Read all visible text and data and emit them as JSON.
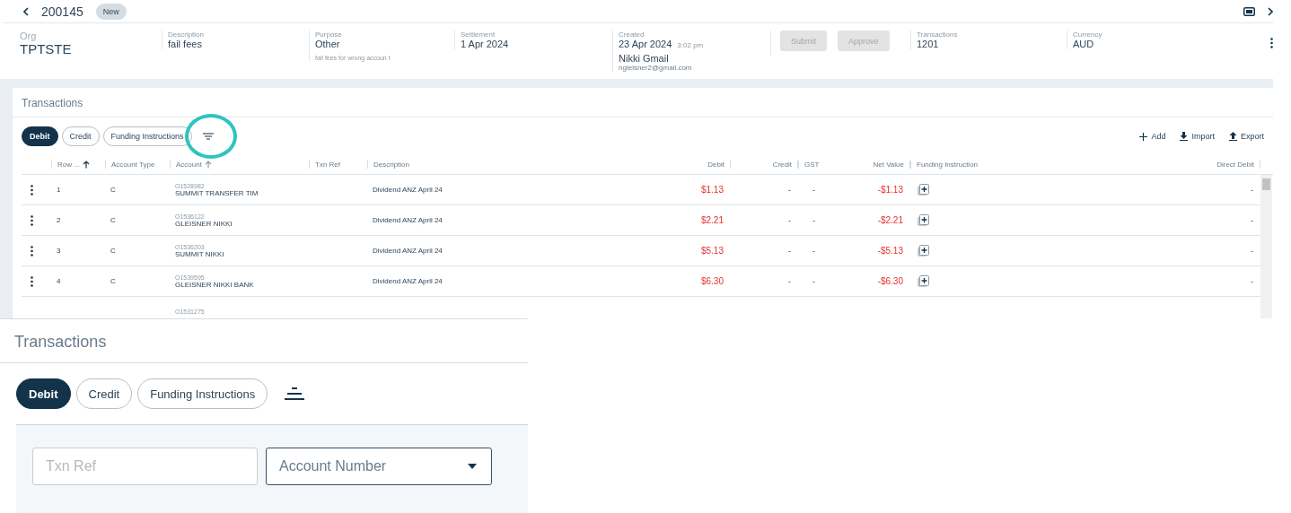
{
  "header": {
    "id": "200145",
    "badge": "New"
  },
  "summary": {
    "org": {
      "label": "Org",
      "value": "TPTSTE"
    },
    "fields": [
      {
        "kind": "plain",
        "label": "Description",
        "value": "fail fees"
      },
      {
        "kind": "note",
        "label": "Purpose",
        "value": "Other",
        "note": "fail fees for wrong accoun t"
      },
      {
        "kind": "plain",
        "label": "Settlement",
        "value": "1 Apr 2024"
      },
      {
        "kind": "created",
        "label": "Created",
        "value": "23 Apr 2024",
        "time": "3:02 pm",
        "name": "Nikki Gmail",
        "email": "ngleisner2@gmail.com"
      },
      {
        "kind": "buttons",
        "buttons": [
          {
            "label": "Submit",
            "disabled": true
          },
          {
            "label": "Approve",
            "disabled": true
          }
        ]
      },
      {
        "kind": "plain",
        "label": "Transactions",
        "value": "1201"
      },
      {
        "kind": "plain",
        "label": "Currency",
        "value": "AUD"
      }
    ]
  },
  "panel": {
    "title": "Transactions",
    "tabs": [
      {
        "label": "Debit",
        "selected": true
      },
      {
        "label": "Credit",
        "selected": false
      },
      {
        "label": "Funding Instructions",
        "selected": false
      }
    ],
    "filter_highlighted": true,
    "actions": [
      {
        "kind": "add",
        "label": "Add"
      },
      {
        "kind": "import",
        "label": "Import"
      },
      {
        "kind": "export",
        "label": "Export"
      }
    ],
    "columns": [
      {
        "label": "Row ...",
        "sorted": true
      },
      {
        "label": "Account Type",
        "sorted": false
      },
      {
        "label": "Account",
        "sorted": true
      },
      {
        "label": "Txn Ref",
        "sorted": false
      },
      {
        "label": "Description",
        "sorted": false
      },
      {
        "label": "Debit",
        "sorted": false
      },
      {
        "label": "Credit",
        "sorted": false
      },
      {
        "label": "GST",
        "sorted": false
      },
      {
        "label": "Net Value",
        "sorted": false
      },
      {
        "label": "Funding Instruction",
        "sorted": false
      },
      {
        "label": "Direct Debit",
        "sorted": false
      }
    ],
    "rows": [
      {
        "row": "1",
        "type": "C",
        "account_number": "O1528982",
        "account_name": "SUMMIT TRANSFER TIM",
        "description": "Dividend ANZ April 24",
        "debit": "$1.13",
        "credit": "-",
        "gst": "-",
        "net": "-$1.13",
        "direct_debit": "-"
      },
      {
        "row": "2",
        "type": "C",
        "account_number": "O1536122",
        "account_name": "GLEISNER NIKKI",
        "description": "Dividend ANZ April 24",
        "debit": "$2.21",
        "credit": "-",
        "gst": "-",
        "net": "-$2.21",
        "direct_debit": "-"
      },
      {
        "row": "3",
        "type": "C",
        "account_number": "O1536203",
        "account_name": "SUMMIT NIKKI",
        "description": "Dividend ANZ April 24",
        "debit": "$5.13",
        "credit": "-",
        "gst": "-",
        "net": "-$5.13",
        "direct_debit": "-"
      },
      {
        "row": "4",
        "type": "C",
        "account_number": "O1539595",
        "account_name": "GLEISNER NIKKI BANK",
        "description": "Dividend ANZ April 24",
        "debit": "$6.30",
        "credit": "-",
        "gst": "-",
        "net": "-$6.30",
        "direct_debit": "-"
      },
      {
        "account_number": "O1531275"
      }
    ]
  },
  "inset": {
    "title": "Transactions",
    "tabs": [
      {
        "label": "Debit",
        "selected": true
      },
      {
        "label": "Credit",
        "selected": false
      },
      {
        "label": "Funding Instructions",
        "selected": false
      }
    ],
    "filters": [
      {
        "kind": "text",
        "placeholder": "Txn Ref"
      },
      {
        "kind": "select",
        "placeholder": "Account Number"
      }
    ]
  }
}
